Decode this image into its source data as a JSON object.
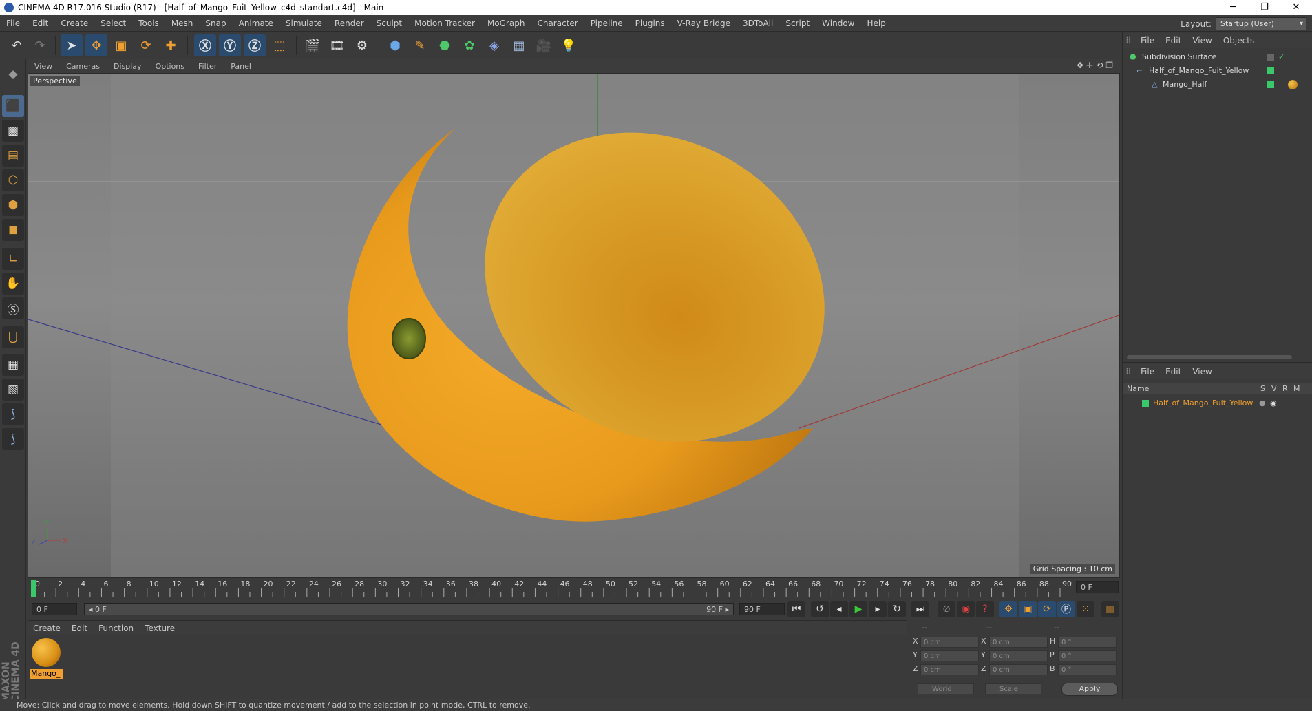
{
  "window": {
    "title": "CINEMA 4D R17.016 Studio (R17) - [Half_of_Mango_Fuit_Yellow_c4d_standart.c4d] - Main",
    "controls": [
      "─",
      "❐",
      "✕"
    ]
  },
  "menubar": {
    "items": [
      "File",
      "Edit",
      "Create",
      "Select",
      "Tools",
      "Mesh",
      "Snap",
      "Animate",
      "Simulate",
      "Render",
      "Sculpt",
      "Motion Tracker",
      "MoGraph",
      "Character",
      "Pipeline",
      "Plugins",
      "V-Ray Bridge",
      "3DToAll",
      "Script",
      "Window",
      "Help"
    ],
    "layout_label": "Layout:",
    "layout_value": "Startup (User)"
  },
  "viewport": {
    "menu": [
      "View",
      "Cameras",
      "Display",
      "Options",
      "Filter",
      "Panel"
    ],
    "label": "Perspective",
    "grid_spacing": "Grid Spacing : 10 cm",
    "nav_icons": "✥✛⟲❐",
    "axis_labels": {
      "y": "Y",
      "z": "Z",
      "x": "X"
    }
  },
  "timeline": {
    "ticks": [
      "0",
      "2",
      "4",
      "6",
      "8",
      "10",
      "12",
      "14",
      "16",
      "18",
      "20",
      "22",
      "24",
      "26",
      "28",
      "30",
      "32",
      "34",
      "36",
      "38",
      "40",
      "42",
      "44",
      "46",
      "48",
      "50",
      "52",
      "54",
      "56",
      "58",
      "60",
      "62",
      "64",
      "66",
      "68",
      "70",
      "72",
      "74",
      "76",
      "78",
      "80",
      "82",
      "84",
      "86",
      "88",
      "90"
    ],
    "current_frame": "0 F"
  },
  "transport": {
    "start_field": "0 F",
    "range_start": "◂ 0 F",
    "range_end": "90 F ▸",
    "end_field": "90 F"
  },
  "materials": {
    "menu": [
      "Create",
      "Edit",
      "Function",
      "Texture"
    ],
    "items": [
      {
        "name": "Mango_"
      }
    ]
  },
  "coords": {
    "headers": [
      "--",
      "--",
      "--"
    ],
    "rows": [
      {
        "a1": "X",
        "v1": "0 cm",
        "a2": "X",
        "v2": "0 cm",
        "a3": "H",
        "v3": "0 °"
      },
      {
        "a1": "Y",
        "v1": "0 cm",
        "a2": "Y",
        "v2": "0 cm",
        "a3": "P",
        "v3": "0 °"
      },
      {
        "a1": "Z",
        "v1": "0 cm",
        "a2": "Z",
        "v2": "0 cm",
        "a3": "B",
        "v3": "0 °"
      }
    ],
    "mode1": "World",
    "mode2": "Scale",
    "apply": "Apply"
  },
  "objects": {
    "menu": [
      "File",
      "Edit",
      "View",
      "Objects"
    ],
    "tree": [
      {
        "name": "Subdivision Surface",
        "indent": 0
      },
      {
        "name": "Half_of_Mango_Fuit_Yellow",
        "indent": 1
      },
      {
        "name": "Mango_Half",
        "indent": 2
      }
    ]
  },
  "attributes": {
    "menu": [
      "File",
      "Edit",
      "View"
    ],
    "columns": {
      "name": "Name",
      "s": "S",
      "v": "V",
      "r": "R",
      "m": "M"
    },
    "rows": [
      {
        "name": "Half_of_Mango_Fuit_Yellow"
      }
    ]
  },
  "status": "Move: Click and drag to move elements. Hold down SHIFT to quantize movement / add to the selection in point mode, CTRL to remove.",
  "brand": "MAXON CINEMA 4D",
  "colors": {
    "accent": "#f0a030",
    "selection": "#4a6a90",
    "mango": "#e8a020"
  }
}
